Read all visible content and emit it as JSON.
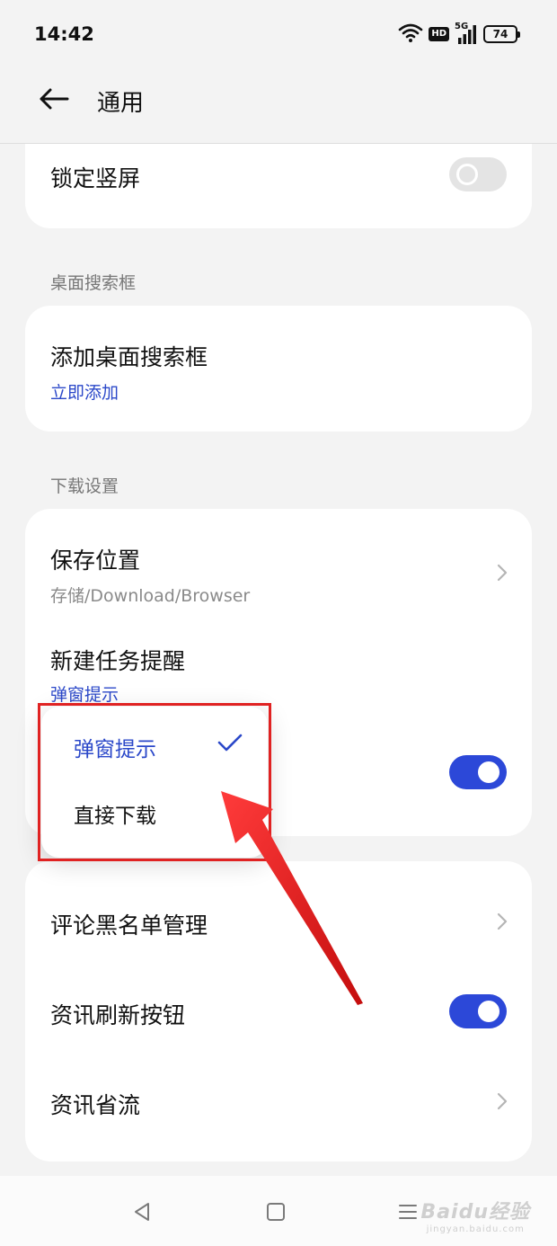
{
  "status_bar": {
    "time": "14:42",
    "battery_level": "74",
    "hd_label": "HD",
    "network_label": "5G"
  },
  "header": {
    "title": "通用"
  },
  "lock_screen": {
    "label": "锁定竖屏",
    "enabled": false
  },
  "search_box_section": {
    "label": "桌面搜索框",
    "item_title": "添加桌面搜索框",
    "item_action": "立即添加"
  },
  "download_section": {
    "label": "下载设置",
    "save_location": {
      "title": "保存位置",
      "value": "存储/Download/Browser"
    },
    "new_task_reminder": {
      "title": "新建任务提醒",
      "value": "弹窗提示"
    },
    "hidden_row_toggle_on": true
  },
  "popup_menu": {
    "options": [
      {
        "label": "弹窗提示",
        "selected": true
      },
      {
        "label": "直接下载",
        "selected": false
      }
    ]
  },
  "more_settings": {
    "comment_blacklist": "评论黑名单管理",
    "news_refresh_button": {
      "label": "资讯刷新按钮",
      "enabled": true
    },
    "news_data_saver": "资讯省流"
  },
  "watermark": {
    "main": "Baidu经验",
    "sub": "jingyan.baidu.com"
  },
  "colors": {
    "accent": "#2c48d8",
    "highlight": "#e02222",
    "background": "#f3f3f3"
  }
}
